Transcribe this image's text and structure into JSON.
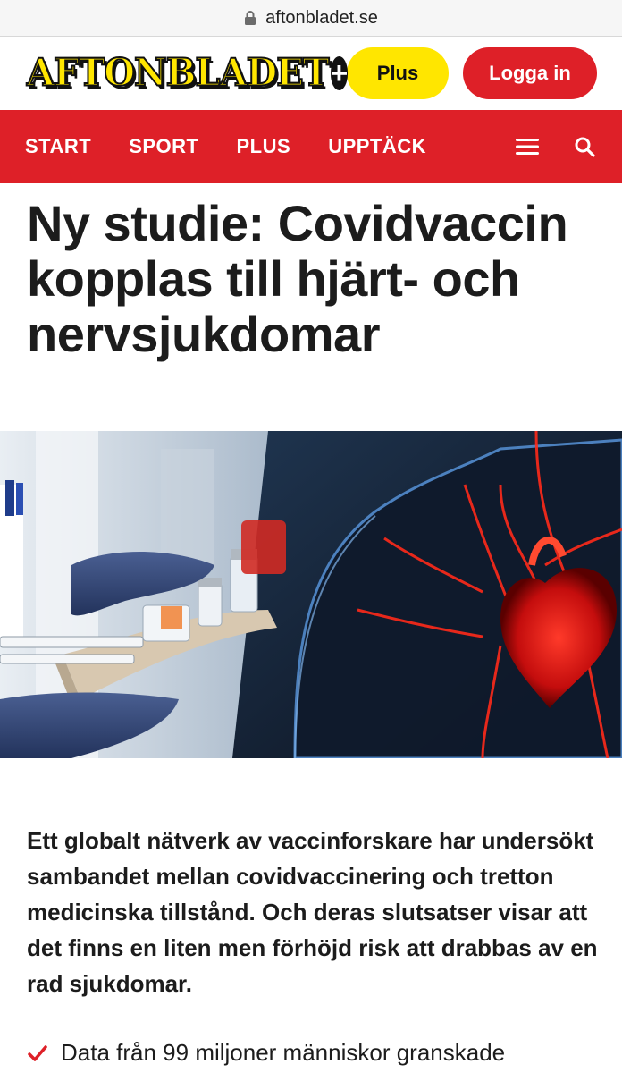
{
  "browser": {
    "url": "aftonbladet.se"
  },
  "header": {
    "logo_text": "AFTONBLADET",
    "logo_plus": "+",
    "plus_button": "Plus",
    "login_button": "Logga in"
  },
  "nav": {
    "items": [
      "START",
      "SPORT",
      "PLUS",
      "UPPTÄCK"
    ],
    "menu_icon": "hamburger-icon",
    "search_icon": "search-icon"
  },
  "article": {
    "headline": "Ny studie: Covidvaccin kopplas till hjärt- och nervsjukdomar",
    "lead": "Ett globalt nätverk av vaccinforskare har undersökt sambandet mellan covidvaccinering och tretton medicinska tillstånd. Och deras slutsatser visar att det finns en liten men förhöjd risk att drabbas av en rad sjukdomar.",
    "bullets": [
      "Data från 99 miljoner människor granskade"
    ]
  },
  "colors": {
    "brand_red": "#de2028",
    "brand_yellow": "#ffe600"
  }
}
